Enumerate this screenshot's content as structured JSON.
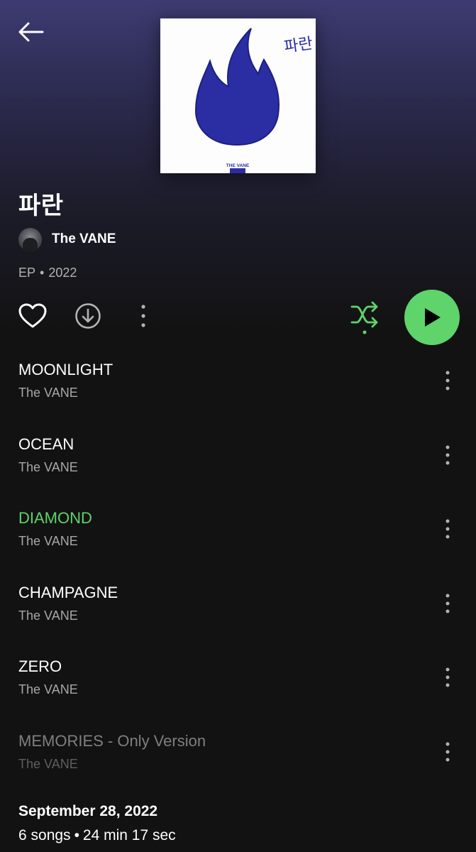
{
  "album": {
    "title": "파란",
    "cover_text": "파란",
    "cover_label": "THE VANE",
    "type": "EP",
    "separator": "•",
    "year": "2022"
  },
  "artist": {
    "name": "The VANE"
  },
  "controls": {
    "back_icon": "arrow-left-icon",
    "like_icon": "heart-outline-icon",
    "download_icon": "download-circle-icon",
    "more_icon": "more-vertical-icon",
    "shuffle_icon": "shuffle-icon",
    "play_icon": "play-icon",
    "shuffle_enabled": true
  },
  "colors": {
    "accent": "#5ed46a",
    "background": "#121212",
    "header_gradient_top": "#3d3b72"
  },
  "tracks": [
    {
      "title": "MOONLIGHT",
      "artist": "The VANE",
      "state": "normal"
    },
    {
      "title": "OCEAN",
      "artist": "The VANE",
      "state": "normal"
    },
    {
      "title": "DIAMOND",
      "artist": "The VANE",
      "state": "playing"
    },
    {
      "title": "CHAMPAGNE",
      "artist": "The VANE",
      "state": "normal"
    },
    {
      "title": "ZERO",
      "artist": "The VANE",
      "state": "normal"
    },
    {
      "title": "MEMORIES - Only Version",
      "artist": "The VANE",
      "state": "unavailable"
    }
  ],
  "footer": {
    "release_date": "September 28, 2022",
    "song_count": "6 songs",
    "separator": "•",
    "duration": "24 min 17 sec"
  }
}
